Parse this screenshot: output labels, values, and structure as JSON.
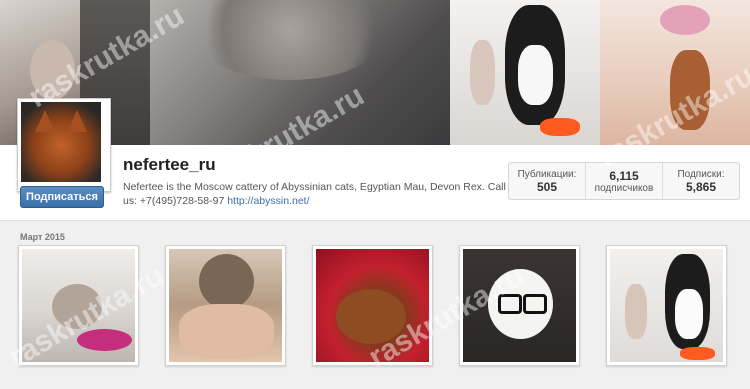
{
  "profile": {
    "username": "nefertee_ru",
    "follow_label": "Подписаться",
    "bio_text": "Nefertee is the Moscow cattery of Abyssinian cats, Egyptian Mau, Devon Rex. Call us: +7(495)728-58-97 ",
    "bio_link": "http://abyssin.net/"
  },
  "stats": [
    {
      "label": "Публикации:",
      "value": "505"
    },
    {
      "label": "подписчиков",
      "value": "6,115"
    },
    {
      "label": "Подписки:",
      "value": "5,865"
    }
  ],
  "feed": {
    "month_label": "Март 2015"
  },
  "watermark": "raskrutka.ru",
  "colors": {
    "follow_button": "#3a6fa8",
    "link": "#3b6ea5"
  }
}
